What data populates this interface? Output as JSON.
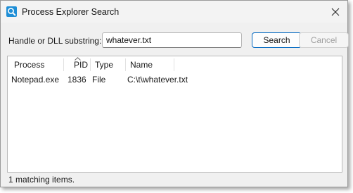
{
  "window": {
    "title": "Process Explorer Search"
  },
  "search": {
    "label": "Handle or DLL substring:",
    "value": "whatever.txt",
    "search_button": "Search",
    "cancel_button": "Cancel"
  },
  "results": {
    "columns": [
      "Process",
      "PID",
      "Type",
      "Name"
    ],
    "sorted_column": "PID",
    "rows": [
      {
        "process": "Notepad.exe",
        "pid": "1836",
        "type": "File",
        "name": "C:\\t\\whatever.txt"
      }
    ]
  },
  "status": {
    "text": "1 matching items."
  },
  "icons": {
    "app": "magnifier-search-icon",
    "close": "close-icon"
  },
  "colors": {
    "accent": "#0067c0",
    "icon_blue": "#1e8ed6"
  }
}
